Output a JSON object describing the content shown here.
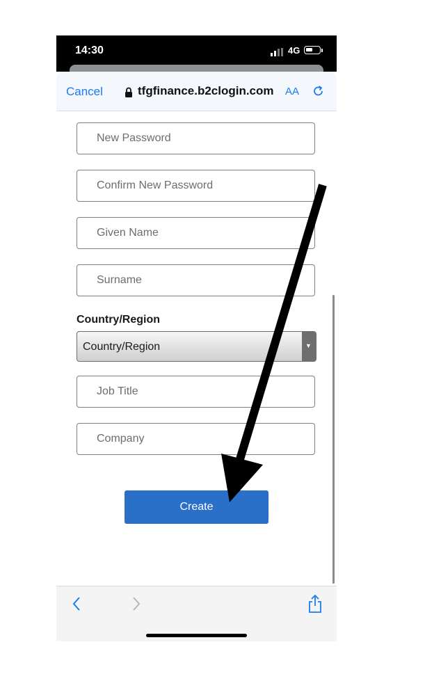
{
  "status_bar": {
    "time": "14:30",
    "network": "4G"
  },
  "browser": {
    "cancel_label": "Cancel",
    "url": "tfgfinance.b2clogin.com",
    "text_size_label": "AA",
    "icons": {
      "lock": "lock-icon",
      "reload": "reload-icon",
      "back": "chevron-left-icon",
      "forward": "chevron-right-icon",
      "share": "share-icon"
    }
  },
  "form": {
    "fields": [
      {
        "placeholder": "New Password"
      },
      {
        "placeholder": "Confirm New Password"
      },
      {
        "placeholder": "Given Name"
      },
      {
        "placeholder": "Surname"
      }
    ],
    "country_label": "Country/Region",
    "country_select_value": "Country/Region",
    "fields_after": [
      {
        "placeholder": "Job Title"
      },
      {
        "placeholder": "Company"
      }
    ],
    "create_label": "Create"
  },
  "colors": {
    "accent": "#1b7bf2",
    "button": "#2a70c9",
    "annotation_arrow": "#000000"
  }
}
